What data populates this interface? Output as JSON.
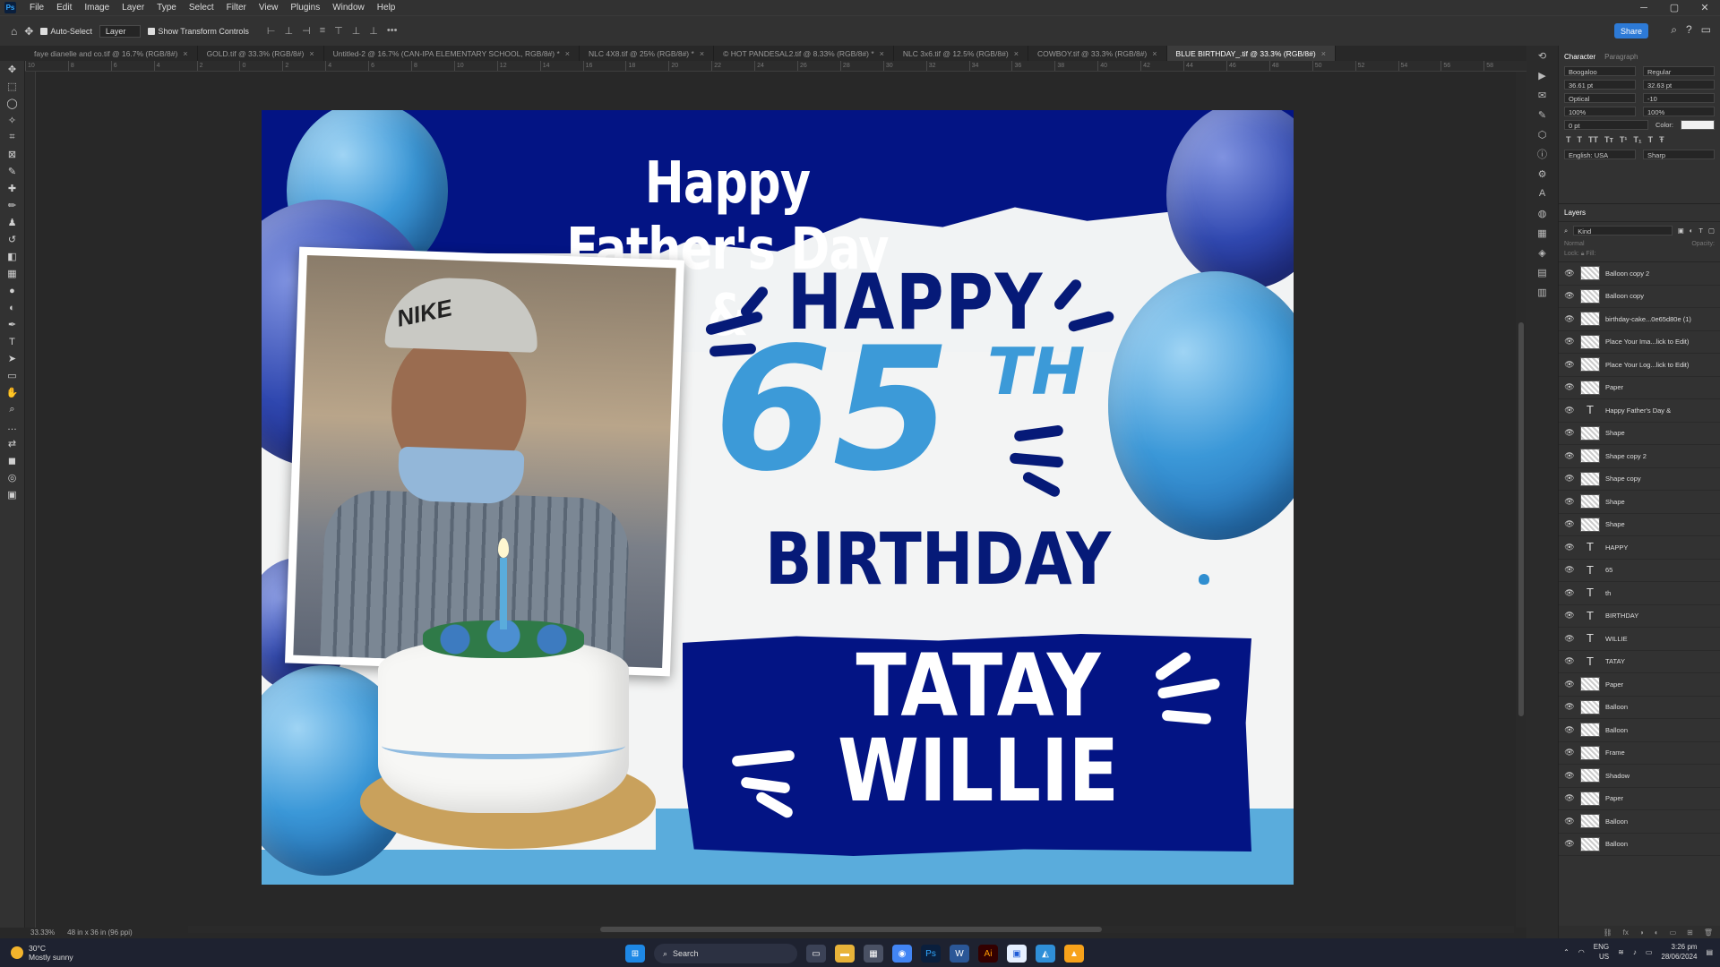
{
  "menu": {
    "logo": "Ps",
    "items": [
      "File",
      "Edit",
      "Image",
      "Layer",
      "Type",
      "Select",
      "Filter",
      "View",
      "Plugins",
      "Window",
      "Help"
    ]
  },
  "window_controls": {
    "minimize": "─",
    "maximize": "▢",
    "close": "✕"
  },
  "options": {
    "auto_select_label": "Auto-Select",
    "layer_select": "Layer",
    "transform_label": "Show Transform Controls",
    "share_label": "Share"
  },
  "tabs": [
    {
      "label": "faye dianelle and co.tif @ 16.7% (RGB/8#)",
      "active": false
    },
    {
      "label": "GOLD.tif @ 33.3% (RGB/8#)",
      "active": false
    },
    {
      "label": "Untitled-2 @ 16.7% (CAN-IPA ELEMENTARY SCHOOL, RGB/8#) *",
      "active": false
    },
    {
      "label": "NLC 4X8.tif @ 25% (RGB/8#) *",
      "active": false
    },
    {
      "label": "© HOT PANDESAL2.tif @ 8.33% (RGB/8#) *",
      "active": false
    },
    {
      "label": "NLC 3x6.tif @ 12.5% (RGB/8#)",
      "active": false
    },
    {
      "label": "COWBOY.tif @ 33.3% (RGB/8#)",
      "active": false
    },
    {
      "label": "BLUE BIRTHDAY_.tif @ 33.3% (RGB/8#)",
      "active": true
    }
  ],
  "ruler_ticks": [
    "10",
    "8",
    "6",
    "4",
    "2",
    "0",
    "2",
    "4",
    "6",
    "8",
    "10",
    "12",
    "14",
    "16",
    "18",
    "20",
    "22",
    "24",
    "26",
    "28",
    "30",
    "32",
    "34",
    "36",
    "38",
    "40",
    "42",
    "44",
    "46",
    "48",
    "50",
    "52",
    "54",
    "56",
    "58"
  ],
  "status": {
    "zoom": "33.33%",
    "doc_size": "48 in x 36 in (96 ppi)"
  },
  "design": {
    "headline": "Happy Father's Day &",
    "happy": "HAPPY",
    "number": "65",
    "suffix": "TH",
    "birthday": "BIRTHDAY",
    "name_line1": "TATAY",
    "name_line2": "WILLIE",
    "cap_logo": "NIKE",
    "colors": {
      "navy": "#031484",
      "light_blue": "#3c9ad8",
      "paper": "#f3f4f4"
    }
  },
  "character_panel": {
    "tab_character": "Character",
    "tab_paragraph": "Paragraph",
    "font_family": "Boogaloo",
    "font_style": "Regular",
    "size": "36.61 pt",
    "leading": "32.63 pt",
    "kerning": "Optical",
    "tracking": "-10",
    "vscale": "100%",
    "hscale": "100%",
    "baseline": "0 pt",
    "color_label": "Color:",
    "language": "English: USA",
    "antialias": "Sharp"
  },
  "layers_panel": {
    "title": "Layers",
    "filter": "Kind",
    "blend": "Normal",
    "opacity_label": "Opacity:",
    "lock_label": "Lock:",
    "fill_label": "Fill:",
    "layers": [
      {
        "name": "Balloon copy 2",
        "type": "image"
      },
      {
        "name": "Balloon copy",
        "type": "image"
      },
      {
        "name": "birthday-cake...0e65d80e (1)",
        "type": "image"
      },
      {
        "name": "Place Your Ima...lick to Edit)",
        "type": "image"
      },
      {
        "name": "Place Your Log...lick to Edit)",
        "type": "image"
      },
      {
        "name": "Paper",
        "type": "image"
      },
      {
        "name": "Happy Father's Day &",
        "type": "text"
      },
      {
        "name": "Shape",
        "type": "image"
      },
      {
        "name": "Shape copy 2",
        "type": "image"
      },
      {
        "name": "Shape copy",
        "type": "image"
      },
      {
        "name": "Shape",
        "type": "image"
      },
      {
        "name": "Shape",
        "type": "image"
      },
      {
        "name": "HAPPY",
        "type": "text"
      },
      {
        "name": "65",
        "type": "text"
      },
      {
        "name": "th",
        "type": "text"
      },
      {
        "name": "BIRTHDAY",
        "type": "text"
      },
      {
        "name": "WILLIE",
        "type": "text"
      },
      {
        "name": "TATAY",
        "type": "text"
      },
      {
        "name": "Paper",
        "type": "image"
      },
      {
        "name": "Balloon",
        "type": "image"
      },
      {
        "name": "Balloon",
        "type": "image"
      },
      {
        "name": "Frame",
        "type": "image"
      },
      {
        "name": "Shadow",
        "type": "image"
      },
      {
        "name": "Paper",
        "type": "image"
      },
      {
        "name": "Balloon",
        "type": "image"
      },
      {
        "name": "Balloon",
        "type": "image"
      }
    ]
  },
  "taskbar": {
    "temperature": "30°C",
    "weather": "Mostly sunny",
    "search_placeholder": "Search",
    "lang_line1": "ENG",
    "lang_line2": "US",
    "time": "3:26 pm",
    "date": "28/06/2024"
  }
}
